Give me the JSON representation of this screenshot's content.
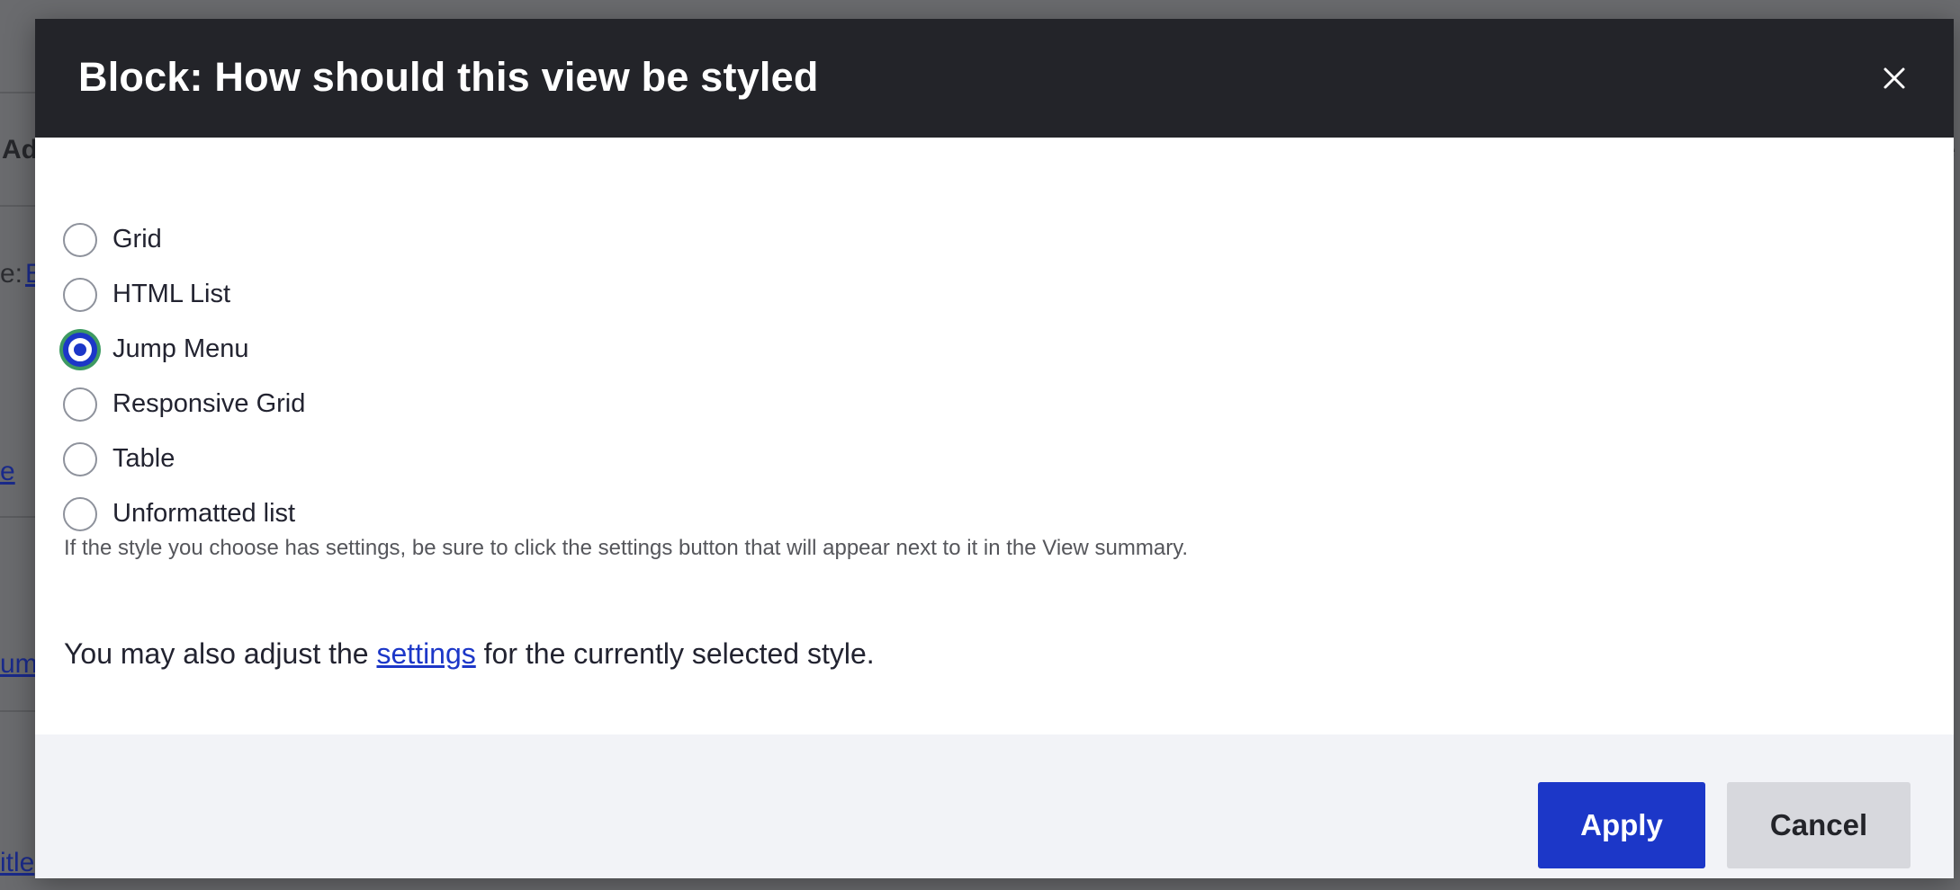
{
  "background": {
    "fragments": [
      {
        "text": "Ad",
        "strong": true
      },
      {
        "text": "e:",
        "strong": false
      },
      {
        "text": "E",
        "link": true
      },
      {
        "text": "e",
        "link": true
      },
      {
        "text": "um",
        "link": true
      },
      {
        "text": "itle",
        "link": true
      },
      {
        "text": "e",
        "strong": true
      }
    ]
  },
  "dialog": {
    "title": "Block: How should this view be styled",
    "close_label": "×",
    "options": [
      {
        "label": "Grid",
        "checked": false
      },
      {
        "label": "HTML List",
        "checked": false
      },
      {
        "label": "Jump Menu",
        "checked": true
      },
      {
        "label": "Responsive Grid",
        "checked": false
      },
      {
        "label": "Table",
        "checked": false
      },
      {
        "label": "Unformatted list",
        "checked": false
      }
    ],
    "help_text": "If the style you choose has settings, be sure to click the settings button that will appear next to it in the View summary.",
    "also_prefix": "You may also adjust the ",
    "also_link": "settings",
    "also_suffix": " for the currently selected style.",
    "apply_label": "Apply",
    "cancel_label": "Cancel"
  },
  "colors": {
    "header_bg": "#232429",
    "primary": "#1c37c8",
    "focus_ring": "#3e9a62",
    "footer_bg": "#f2f3f7"
  }
}
